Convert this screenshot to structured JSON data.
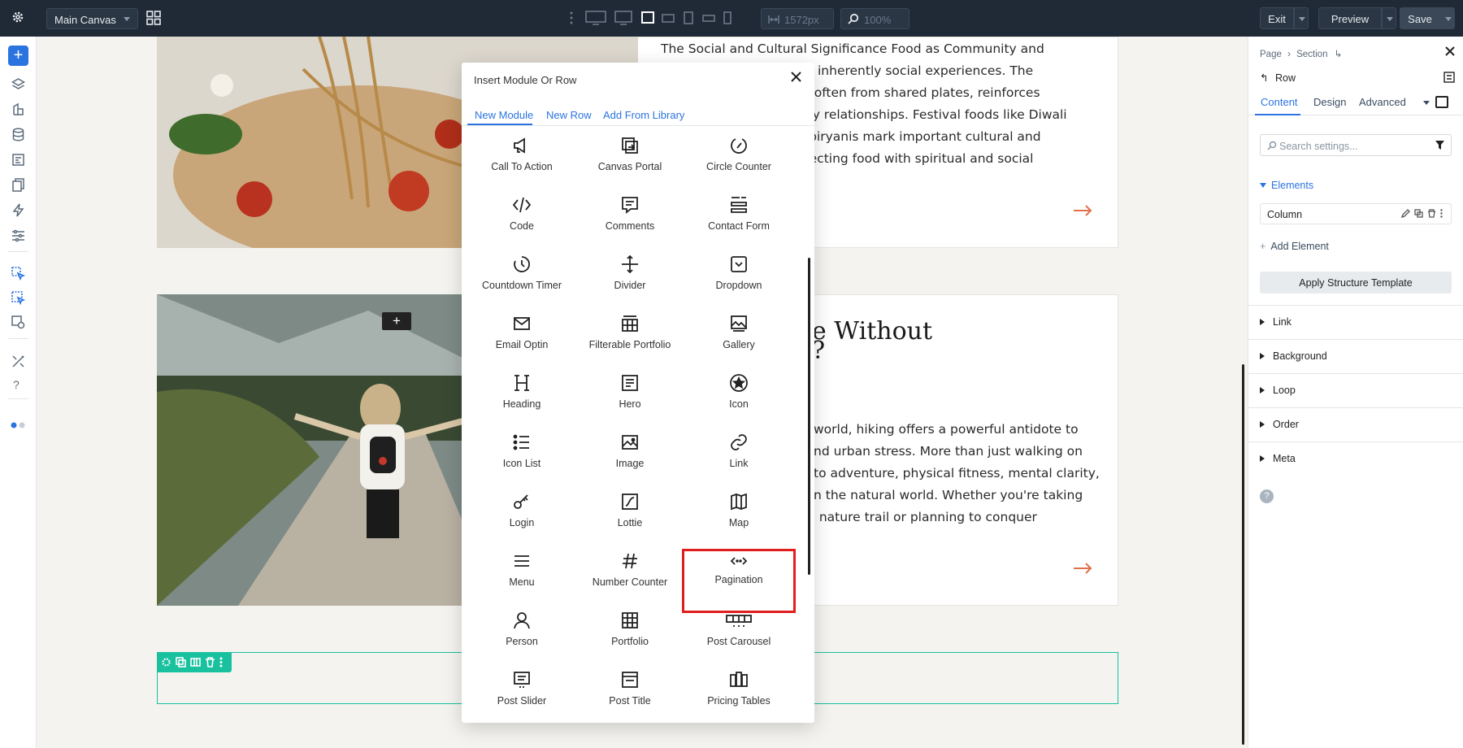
{
  "topbar": {
    "canvas_select": "Main Canvas",
    "width_value": "1572px",
    "zoom_value": "100%",
    "exit_label": "Exit",
    "preview_label": "Preview",
    "save_label": "Save"
  },
  "canvas": {
    "article1_text": [
      "The Social and Cultural Significance Food as Community and",
      "are inherently social experiences. The",
      "er, often from shared plates, reinforces",
      "mily relationships. Festival foods like Diwali",
      "id biryanis mark important cultural and",
      "nnecting food with spiritual and social"
    ],
    "article2_title": [
      "e Without",
      "?"
    ],
    "article2_text": [
      "world, hiking offers a powerful antidote to",
      "nd urban stress. More than just walking on",
      "to adventure, physical fitness, mental clarity,",
      "n the natural world. Whether you're taking",
      ". nature trail or planning to conquer"
    ],
    "accent_color": "#e0704a",
    "row_outline_color": "#19c19f"
  },
  "modal": {
    "title": "Insert Module Or Row",
    "tabs": [
      {
        "label": "New Module",
        "active": true
      },
      {
        "label": "New Row",
        "active": false
      },
      {
        "label": "Add From Library",
        "active": false
      }
    ],
    "modules": [
      {
        "label": "Call To Action",
        "icon": "megaphone-icon"
      },
      {
        "label": "Canvas Portal",
        "icon": "portal-icon"
      },
      {
        "label": "Circle Counter",
        "icon": "circle-counter-icon"
      },
      {
        "label": "Code",
        "icon": "code-icon"
      },
      {
        "label": "Comments",
        "icon": "comments-icon"
      },
      {
        "label": "Contact Form",
        "icon": "contact-form-icon"
      },
      {
        "label": "Countdown Timer",
        "icon": "timer-icon"
      },
      {
        "label": "Divider",
        "icon": "divider-icon"
      },
      {
        "label": "Dropdown",
        "icon": "dropdown-icon"
      },
      {
        "label": "Email Optin",
        "icon": "email-icon"
      },
      {
        "label": "Filterable Portfolio",
        "icon": "filterable-portfolio-icon"
      },
      {
        "label": "Gallery",
        "icon": "gallery-icon"
      },
      {
        "label": "Heading",
        "icon": "heading-icon"
      },
      {
        "label": "Hero",
        "icon": "hero-icon"
      },
      {
        "label": "Icon",
        "icon": "star-circle-icon"
      },
      {
        "label": "Icon List",
        "icon": "icon-list-icon"
      },
      {
        "label": "Image",
        "icon": "image-icon"
      },
      {
        "label": "Link",
        "icon": "link-icon"
      },
      {
        "label": "Login",
        "icon": "key-icon"
      },
      {
        "label": "Lottie",
        "icon": "lottie-icon"
      },
      {
        "label": "Map",
        "icon": "map-icon"
      },
      {
        "label": "Menu",
        "icon": "menu-icon"
      },
      {
        "label": "Number Counter",
        "icon": "hash-icon"
      },
      {
        "label": "Pagination",
        "icon": "pagination-icon",
        "highlighted": true
      },
      {
        "label": "Person",
        "icon": "person-icon"
      },
      {
        "label": "Portfolio",
        "icon": "portfolio-icon"
      },
      {
        "label": "Post Carousel",
        "icon": "carousel-icon"
      },
      {
        "label": "Post Slider",
        "icon": "post-slider-icon"
      },
      {
        "label": "Post Title",
        "icon": "post-title-icon"
      },
      {
        "label": "Pricing Tables",
        "icon": "pricing-tables-icon"
      }
    ],
    "highlight_color": "#e11d1d"
  },
  "panel": {
    "breadcrumb_page": "Page",
    "breadcrumb_section": "Section",
    "element_label": "Row",
    "tabs": [
      {
        "label": "Content",
        "active": true
      },
      {
        "label": "Design",
        "active": false
      },
      {
        "label": "Advanced",
        "active": false
      }
    ],
    "search_placeholder": "Search settings...",
    "elements_heading": "Elements",
    "column_label": "Column",
    "add_element_label": "Add Element",
    "apply_label": "Apply Structure Template",
    "sections": [
      "Link",
      "Background",
      "Loop",
      "Order",
      "Meta"
    ],
    "help_label": "?",
    "accent_color": "#2b74e0"
  }
}
